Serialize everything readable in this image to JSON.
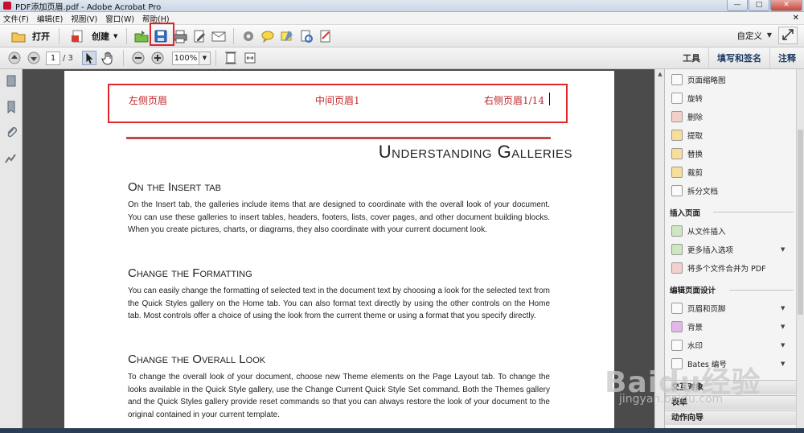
{
  "window": {
    "title": "PDF添加页眉.pdf - Adobe Acrobat Pro",
    "controls": [
      "—",
      "□",
      "✕"
    ]
  },
  "menubar": {
    "items": [
      "文件(F)",
      "编辑(E)",
      "视图(V)",
      "窗口(W)",
      "帮助(H)"
    ],
    "close": "✕"
  },
  "toolbar1": {
    "open_label": "打开",
    "create_label": "创建",
    "customize_label": "自定义"
  },
  "toolbar2": {
    "page_current": "1",
    "page_total": "/ 3",
    "zoom": "100%",
    "tabs": [
      "工具",
      "填写和签名",
      "注释"
    ]
  },
  "document": {
    "header_left": "左侧页眉",
    "header_center": "中间页眉1",
    "header_right": "右侧页眉1/14",
    "title": "Understanding Galleries",
    "sections": [
      {
        "heading": "On the Insert tab",
        "body": "On the Insert tab, the galleries include items that are designed to coordinate with the overall look of your document. You can use these galleries to insert tables, headers, footers, lists, cover pages, and other document building blocks. When you create pictures, charts, or diagrams, they also coordinate with your current document look."
      },
      {
        "heading": "Change the Formatting",
        "body": "You can easily change the formatting of selected text in the document text by choosing a look for the selected text from the Quick Styles gallery on the Home tab. You can also format text directly by using the other controls on the Home tab. Most controls offer a choice of using the look from the current theme or using a format that you specify directly."
      },
      {
        "heading": "Change the Overall Look",
        "body": "To change the overall look of your document, choose new Theme elements on the Page Layout tab. To change the looks available in the Quick Style gallery, use the Change Current Quick Style Set command. Both the Themes gallery and the Quick Styles gallery provide reset commands so that you can always restore the look of your document to the original contained in your current template."
      }
    ]
  },
  "rightpanel": {
    "top_items": [
      "页面缩略图",
      "旋转",
      "删除",
      "提取",
      "替换",
      "裁剪",
      "拆分文档"
    ],
    "insert_heading": "插入页面",
    "insert_items": [
      "从文件插入",
      "更多插入选项",
      "将多个文件合并为 PDF"
    ],
    "design_heading": "编辑页面设计",
    "design_items": [
      "页眉和页脚",
      "背景",
      "水印",
      "Bates 编号"
    ],
    "bottom_sections": [
      "交互对象",
      "表单",
      "动作向导"
    ]
  },
  "watermark": {
    "logo": "Baidu经验",
    "url": "jingyan.baidu.com"
  },
  "colors": {
    "accent_red": "#e0242b",
    "header_text": "#c2242a",
    "rule": "#c14b4b"
  }
}
